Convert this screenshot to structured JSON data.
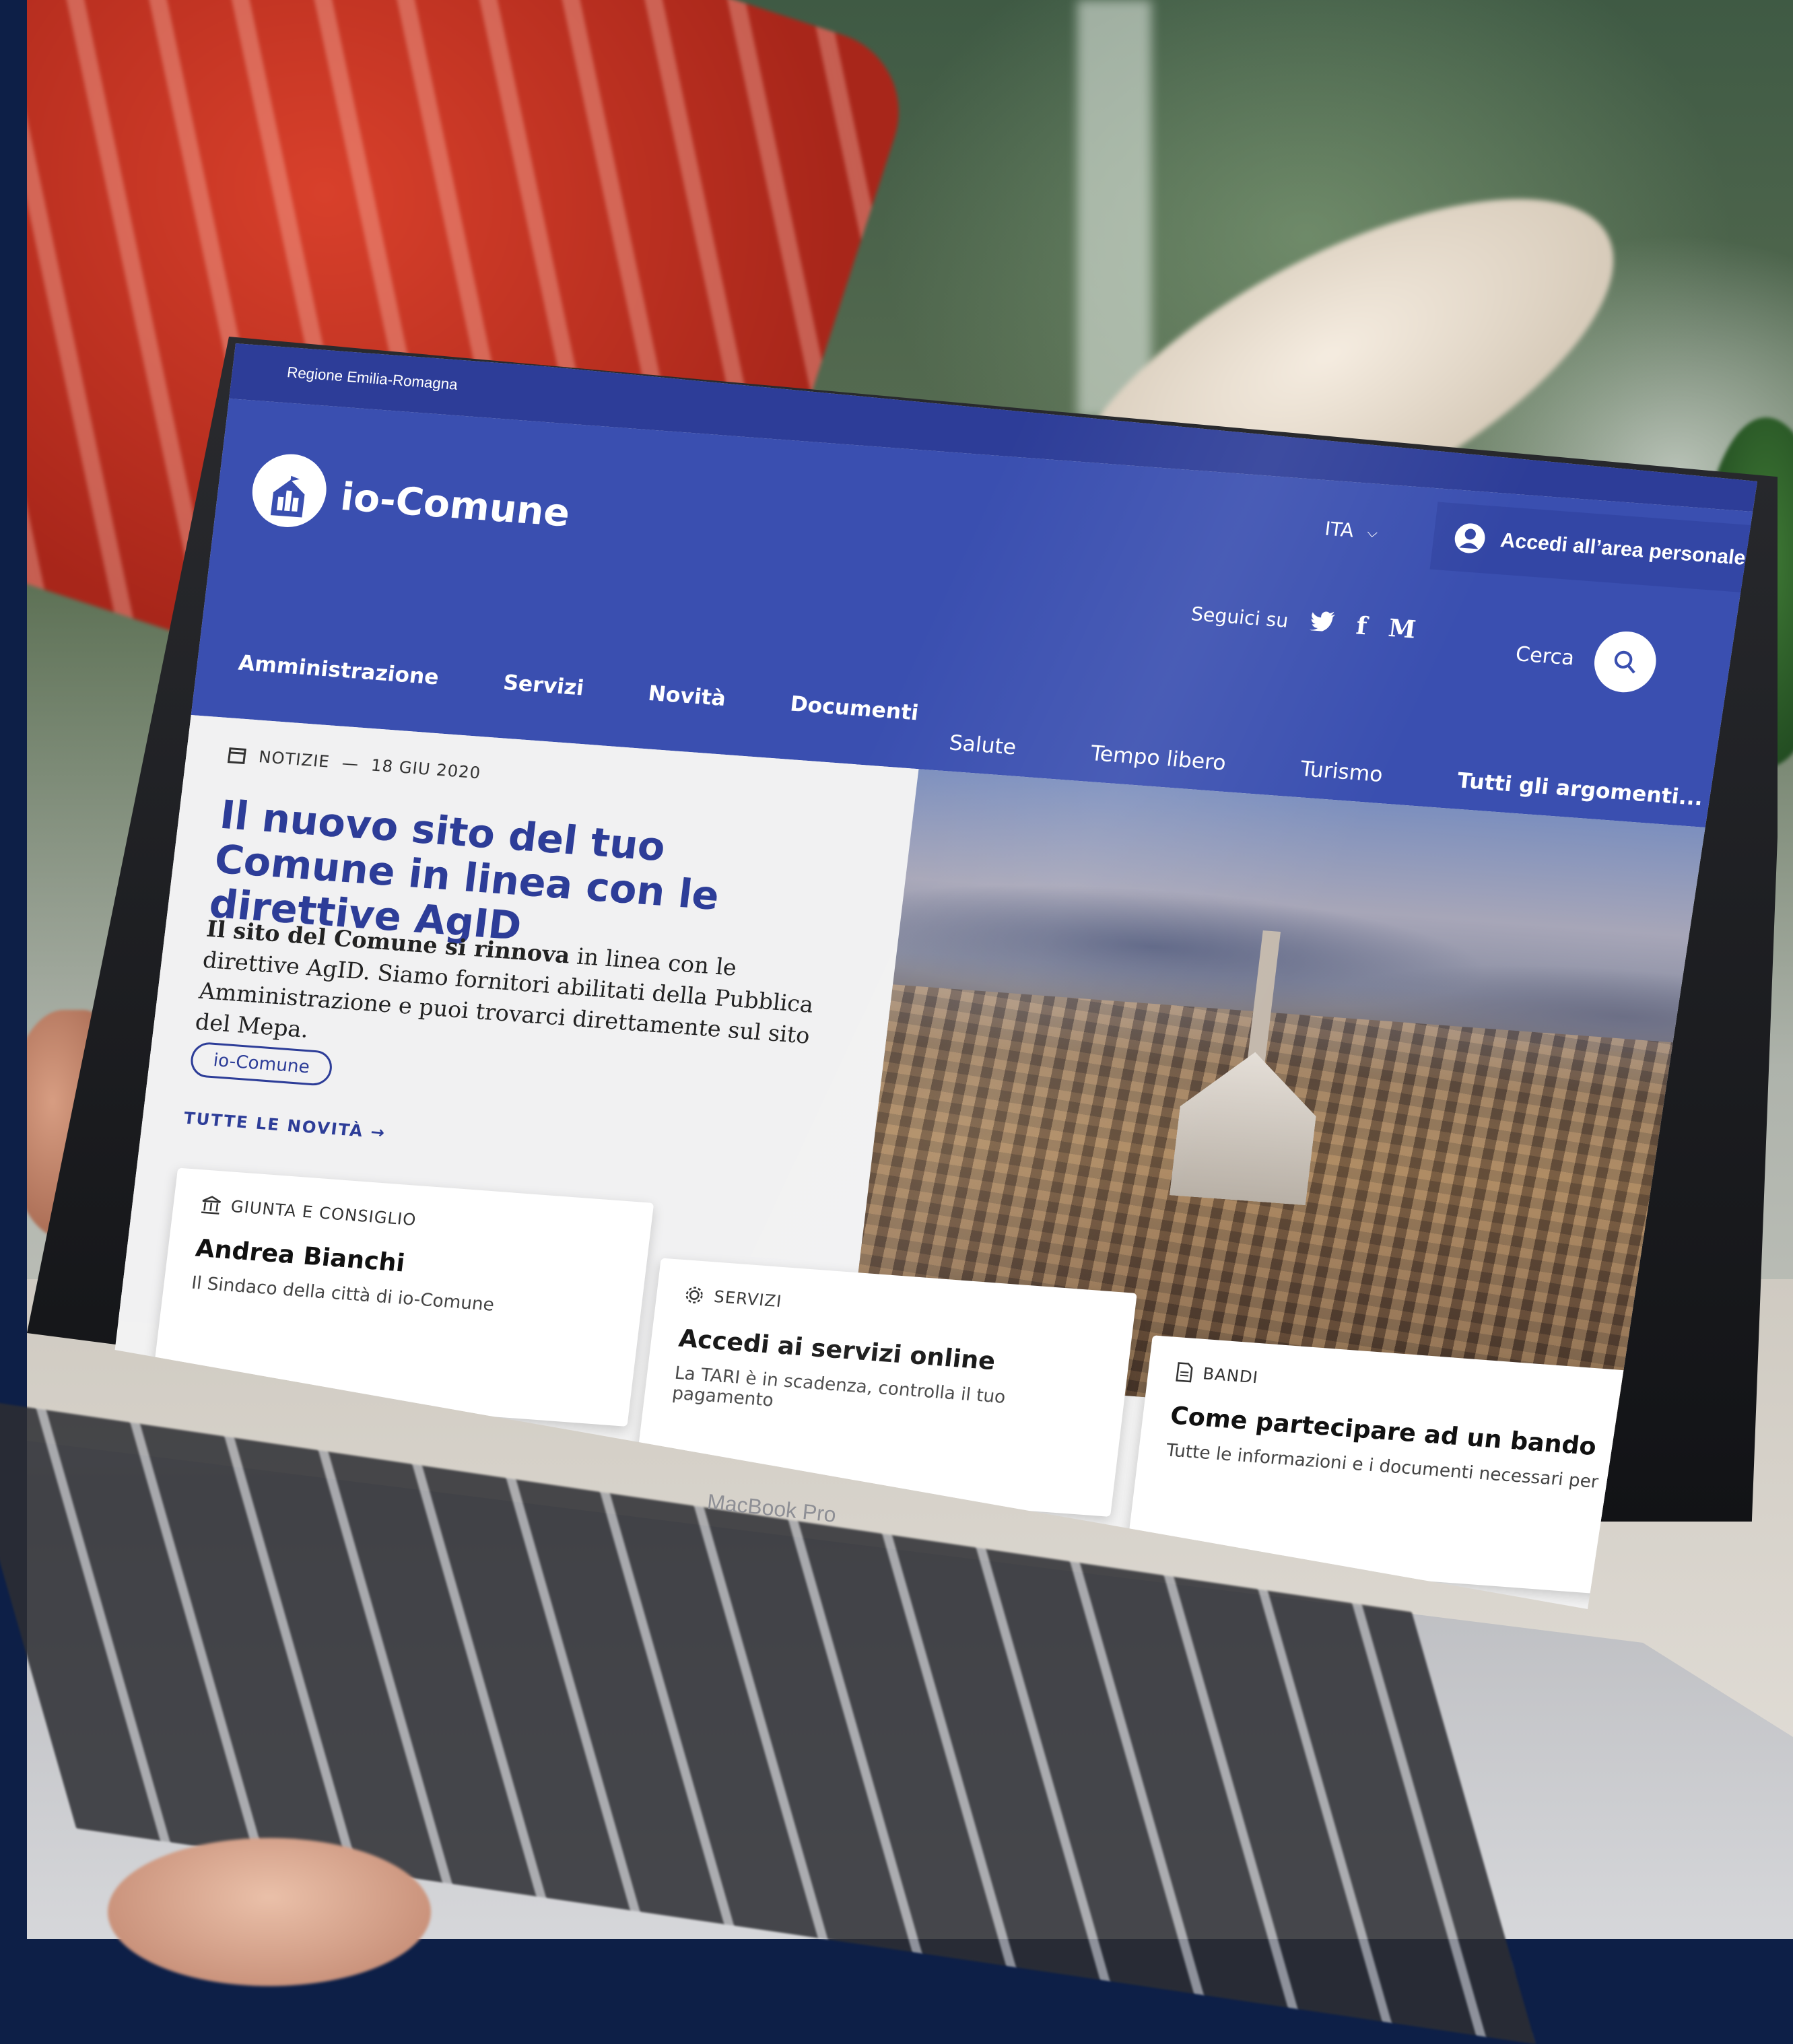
{
  "device": {
    "brand": "MacBook Pro"
  },
  "site": {
    "region": "Regione Emilia-Romagna",
    "logo_name": "io-Comune",
    "language": "ITA",
    "login_label": "Accedi all’area personale",
    "follow_label": "Seguici su",
    "social": [
      {
        "name": "twitter-icon",
        "glyph": "🐦"
      },
      {
        "name": "facebook-icon",
        "glyph": "f"
      },
      {
        "name": "medium-icon",
        "glyph": "M"
      }
    ],
    "search_label": "Cerca",
    "nav": [
      "Amministrazione",
      "Servizi",
      "Novità",
      "Documenti"
    ],
    "topics": [
      "Salute",
      "Tempo libero",
      "Turismo"
    ],
    "topics_all": "Tutti gli argomenti...",
    "colors": {
      "primary": "#3a4fb0",
      "topbar": "#2d3d98"
    }
  },
  "hero": {
    "category": "NOTIZIE",
    "date": "18 GIU 2020",
    "headline": "Il nuovo sito del tuo Comune in linea con le direttive AgID",
    "lead_bold": "Il sito del Comune si rinnova",
    "lead_rest": " in linea con le direttive AgID. Siamo fornitori abilitati della Pubblica Amministrazione e puoi trovarci direttamente sul sito del Mepa.",
    "tag": "io-Comune",
    "all_news": "TUTTE LE NOVITÀ →"
  },
  "cards": [
    {
      "category": "GIUNTA E CONSIGLIO",
      "title": "Andrea Bianchi",
      "subtitle": "Il Sindaco della città di io-Comune"
    },
    {
      "category": "SERVIZI",
      "title": "Accedi ai servizi online",
      "subtitle": "La TARI è in scadenza, controlla il tuo pagamento"
    },
    {
      "category": "BANDI",
      "title": "Come partecipare ad un bando",
      "subtitle": "Tutte le informazioni e i documenti necessari per"
    }
  ]
}
